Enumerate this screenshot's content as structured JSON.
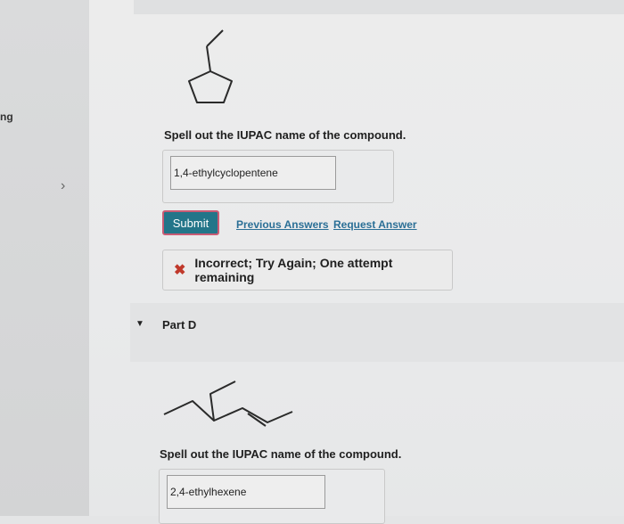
{
  "nav": {
    "label": "ng",
    "chevron": "›"
  },
  "question_c": {
    "prompt": "Spell out the IUPAC name of the compound.",
    "answer": "1,4-ethylcyclopentene"
  },
  "actions": {
    "submit_label": "Submit",
    "previous_answers_label": "Previous Answers",
    "request_answer_label": "Request Answer"
  },
  "feedback": {
    "icon": "x-icon",
    "status_color": "#c0392b",
    "message": "Incorrect; Try Again; One attempt remaining"
  },
  "part_d": {
    "label": "Part D",
    "prompt": "Spell out the IUPAC name of the compound.",
    "answer": "2,4-ethylhexene"
  },
  "colors": {
    "accent": "#237589",
    "link": "#2b6f96"
  }
}
